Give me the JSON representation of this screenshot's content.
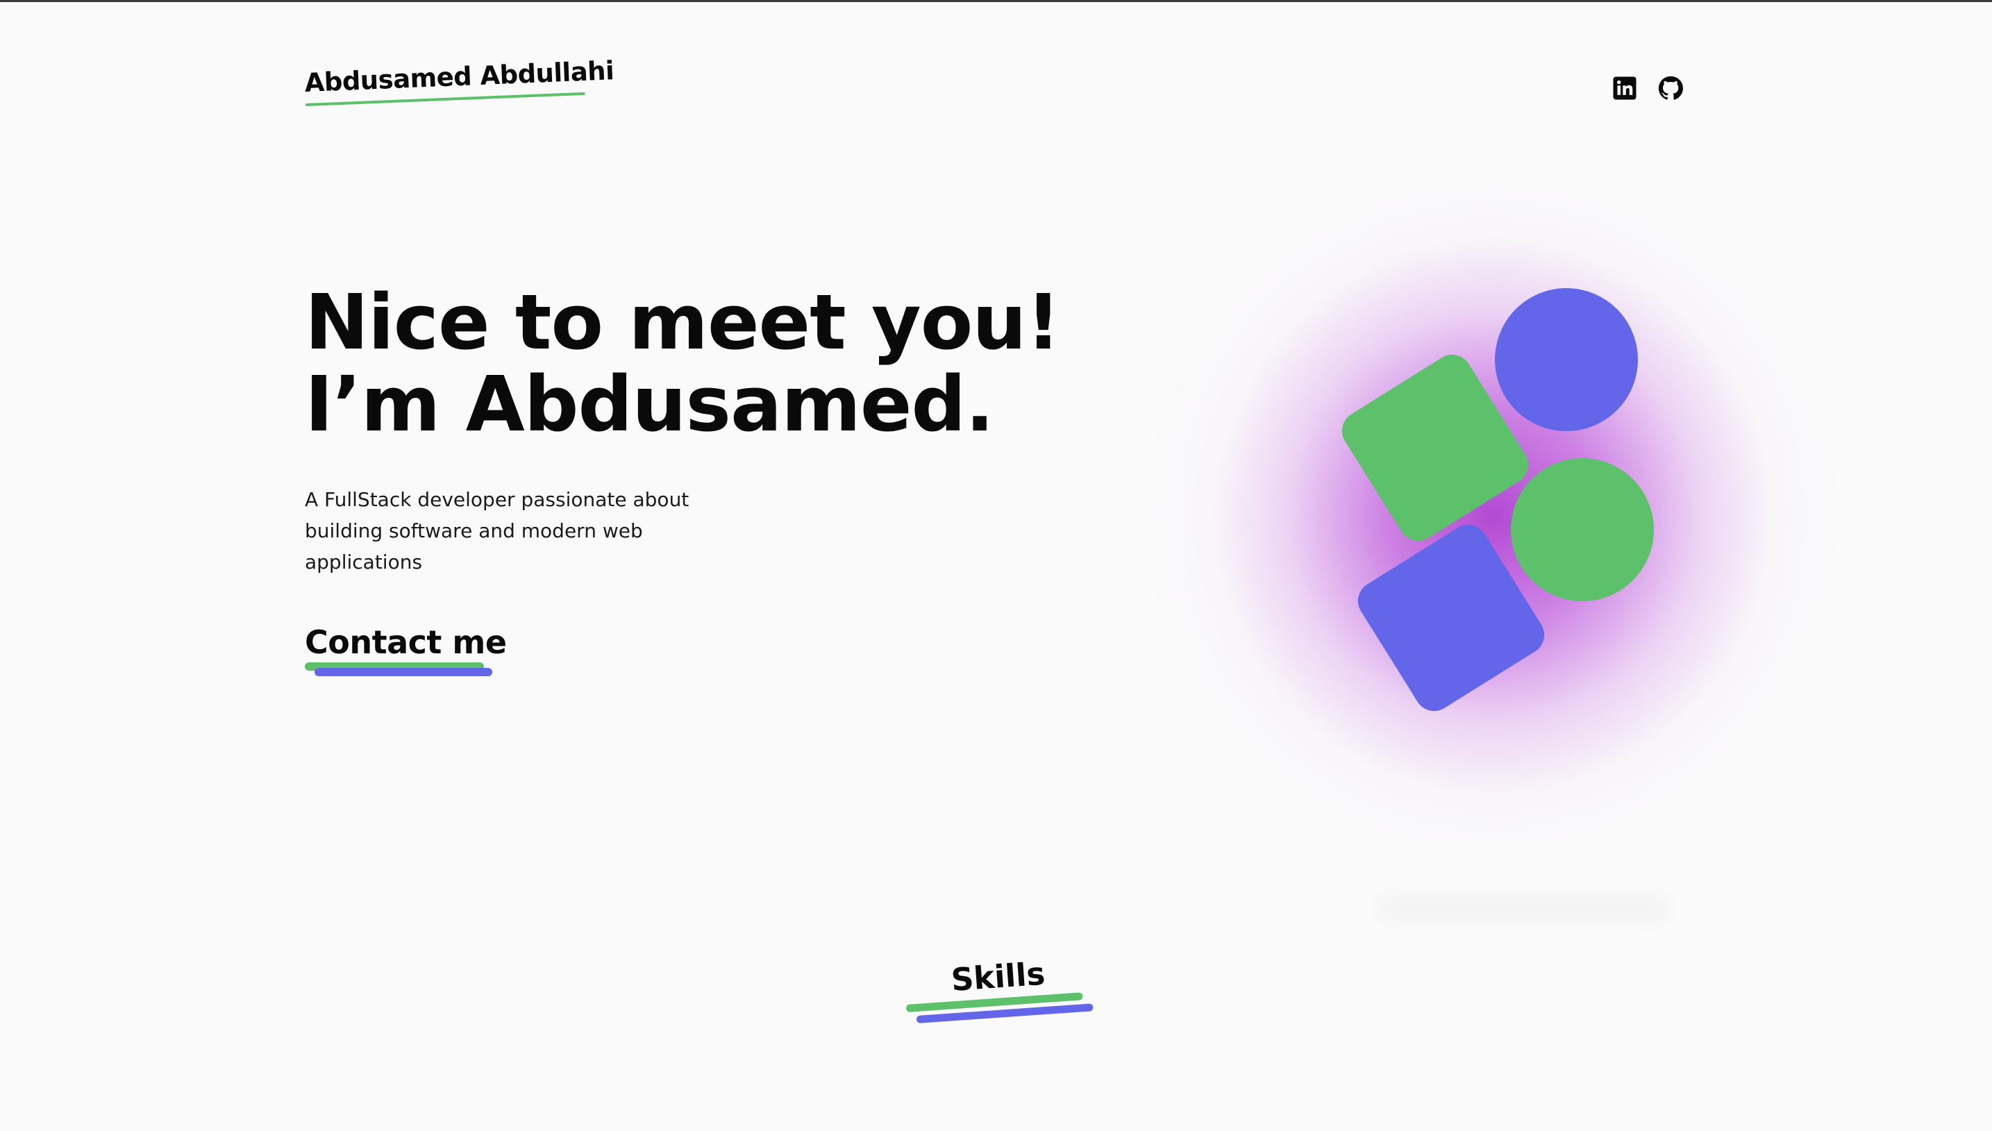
{
  "header": {
    "brand": "Abdusamed Abdullahi",
    "social": [
      {
        "icon": "linkedin-icon"
      },
      {
        "icon": "github-icon"
      }
    ]
  },
  "hero": {
    "title_line1": "Nice to meet you!",
    "title_line2": "I’m Abdusamed.",
    "subtitle": "A FullStack developer passionate about building software and modern web applications",
    "cta_label": "Contact me"
  },
  "sections": {
    "skills_label": "Skills"
  },
  "colors": {
    "background": "#fafafa",
    "text": "#0a0a0a",
    "accent_green": "#5cc16a",
    "accent_blue": "#6366e8",
    "glow_purple": "#b040d2"
  }
}
